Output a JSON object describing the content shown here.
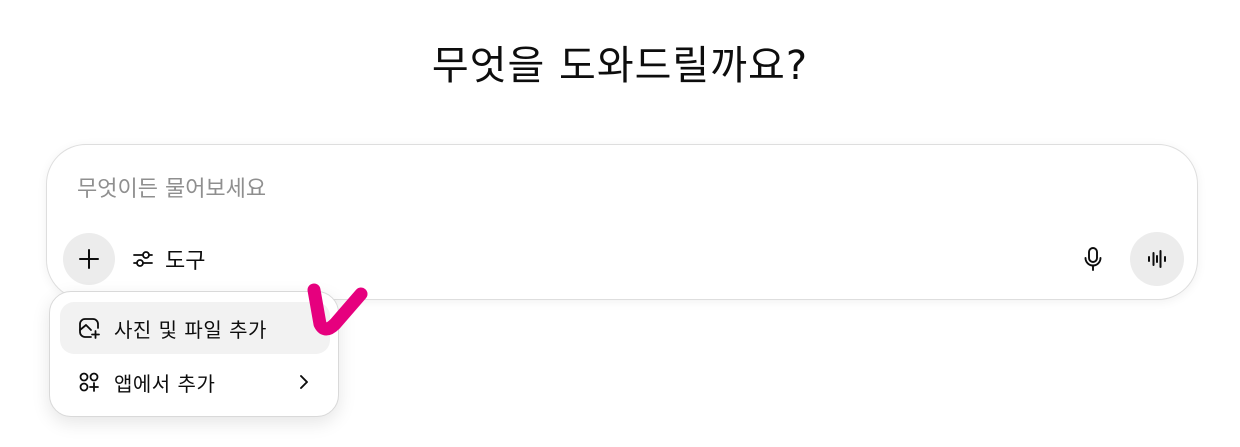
{
  "heading": {
    "title": "무엇을 도와드릴까요?"
  },
  "composer": {
    "placeholder": "무엇이든 물어보세요",
    "value": "",
    "tools_label": "도구",
    "icons": {
      "plus": "plus-icon",
      "tools": "sliders-icon",
      "mic": "microphone-icon",
      "voice": "voice-waveform-icon"
    }
  },
  "attach_menu": {
    "items": [
      {
        "label": "사진 및 파일 추가",
        "icon": "add-file-icon",
        "highlighted": true
      },
      {
        "label": "앱에서 추가",
        "icon": "apps-add-icon",
        "has_submenu": true
      }
    ]
  },
  "annotation": {
    "color": "#e6007e",
    "shape": "checkmark"
  }
}
